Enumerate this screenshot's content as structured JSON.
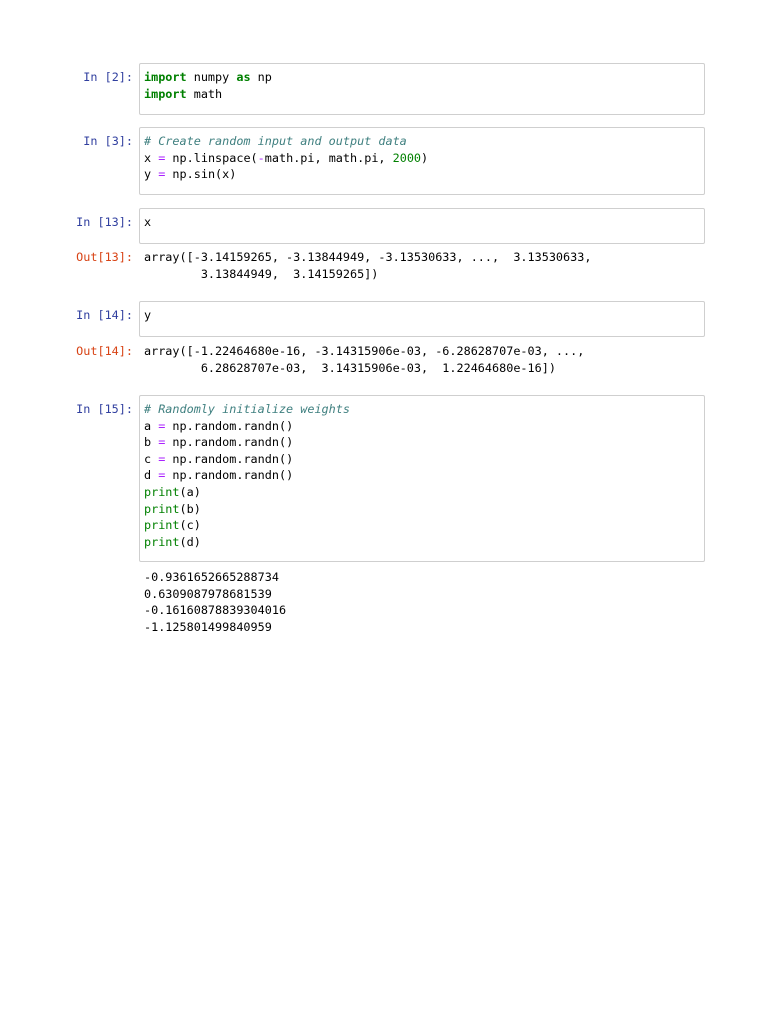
{
  "cells": [
    {
      "prompt": "In [2]:",
      "lines": [
        [
          [
            "import",
            "kw"
          ],
          [
            " numpy ",
            ""
          ],
          [
            "as",
            "kw"
          ],
          [
            " np",
            ""
          ]
        ],
        [
          [
            "import",
            "kw"
          ],
          [
            " math",
            ""
          ]
        ]
      ]
    },
    {
      "prompt": "In [3]:",
      "lines": [
        [
          [
            "# Create random input and output data",
            "cm"
          ]
        ],
        [
          [
            "x ",
            ""
          ],
          [
            "=",
            "op"
          ],
          [
            " np.linspace(",
            ""
          ],
          [
            "-",
            "op"
          ],
          [
            "math.pi, math.pi, ",
            ""
          ],
          [
            "2000",
            "num"
          ],
          [
            ")",
            ""
          ]
        ],
        [
          [
            "y ",
            ""
          ],
          [
            "=",
            "op"
          ],
          [
            " np.sin(x)",
            ""
          ]
        ]
      ]
    },
    {
      "prompt": "In [13]:",
      "lines": [
        [
          [
            "x",
            ""
          ]
        ]
      ],
      "out_prompt": "Out[13]:",
      "output": [
        "array([-3.14159265, -3.13844949, -3.13530633, ...,  3.13530633,",
        "        3.13844949,  3.14159265])"
      ]
    },
    {
      "prompt": "In [14]:",
      "lines": [
        [
          [
            "y",
            ""
          ]
        ]
      ],
      "out_prompt": "Out[14]:",
      "output": [
        "array([-1.22464680e-16, -3.14315906e-03, -6.28628707e-03, ...,",
        "        6.28628707e-03,  3.14315906e-03,  1.22464680e-16])"
      ]
    },
    {
      "prompt": "In [15]:",
      "lines": [
        [
          [
            "# Randomly initialize weights",
            "cm"
          ]
        ],
        [
          [
            "a ",
            ""
          ],
          [
            "=",
            "op"
          ],
          [
            " np.random.randn()",
            ""
          ]
        ],
        [
          [
            "b ",
            ""
          ],
          [
            "=",
            "op"
          ],
          [
            " np.random.randn()",
            ""
          ]
        ],
        [
          [
            "c ",
            ""
          ],
          [
            "=",
            "op"
          ],
          [
            " np.random.randn()",
            ""
          ]
        ],
        [
          [
            "d ",
            ""
          ],
          [
            "=",
            "op"
          ],
          [
            " np.random.randn()",
            ""
          ]
        ],
        [
          [
            "print",
            "bi"
          ],
          [
            "(a)",
            ""
          ]
        ],
        [
          [
            "print",
            "bi"
          ],
          [
            "(b)",
            ""
          ]
        ],
        [
          [
            "print",
            "bi"
          ],
          [
            "(c)",
            ""
          ]
        ],
        [
          [
            "print",
            "bi"
          ],
          [
            "(d)",
            ""
          ]
        ]
      ],
      "stream": [
        "-0.9361652665288734",
        "0.6309087978681539",
        "-0.16160878839304016",
        "-1.125801499840959"
      ]
    }
  ]
}
